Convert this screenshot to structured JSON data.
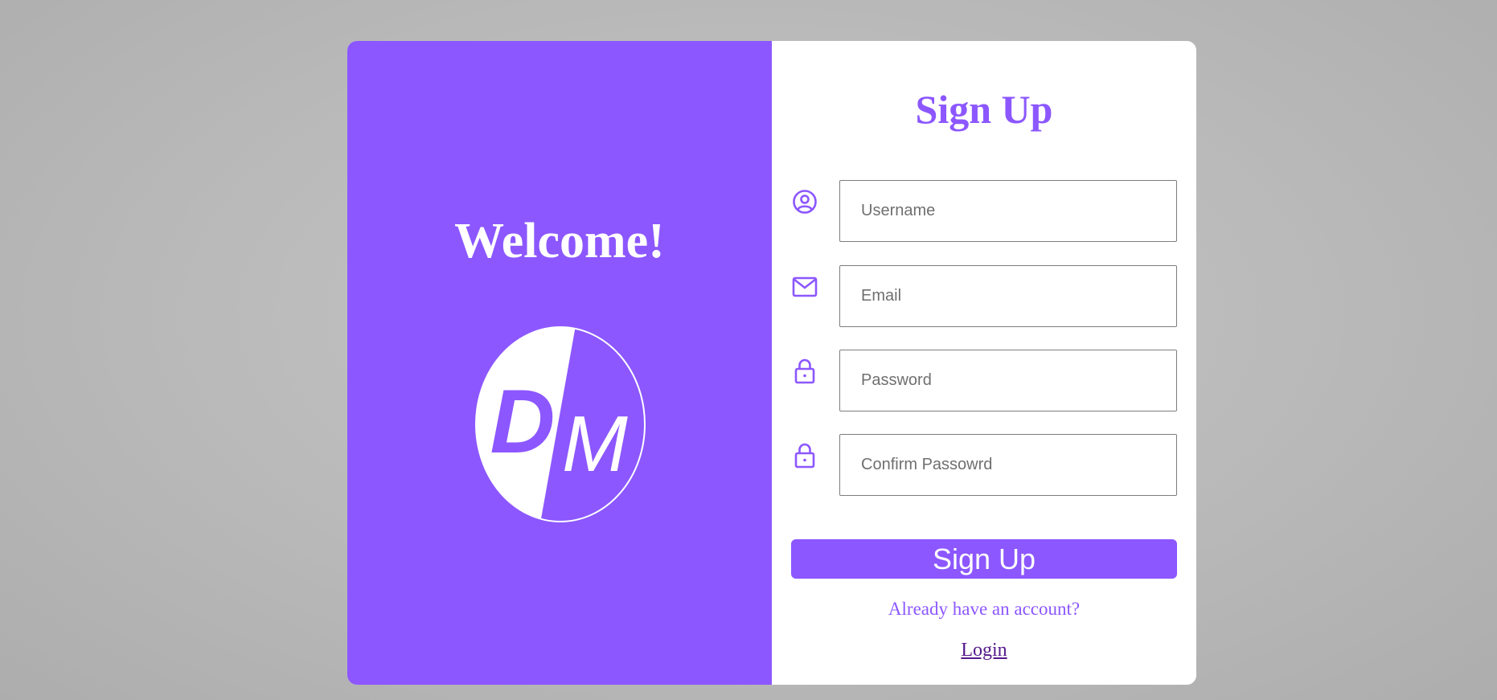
{
  "colors": {
    "accent": "#8c57ff",
    "panel_text": "#ffffff",
    "link": "#551a8b",
    "input_border": "#7d7d7d"
  },
  "left_panel": {
    "welcome": "Welcome!",
    "logo": {
      "letters": "DM",
      "icon": "dm-logo-icon"
    }
  },
  "form": {
    "title": "Sign Up",
    "fields": [
      {
        "icon": "user-circle-icon",
        "placeholder": "Username",
        "value": ""
      },
      {
        "icon": "mail-icon",
        "placeholder": "Email",
        "value": ""
      },
      {
        "icon": "lock-icon",
        "placeholder": "Password",
        "value": ""
      },
      {
        "icon": "lock-icon",
        "placeholder": "Confirm Passowrd",
        "value": ""
      }
    ],
    "submit_label": "Sign Up",
    "account_prompt": "Already have an account?",
    "login_label": "Login"
  }
}
